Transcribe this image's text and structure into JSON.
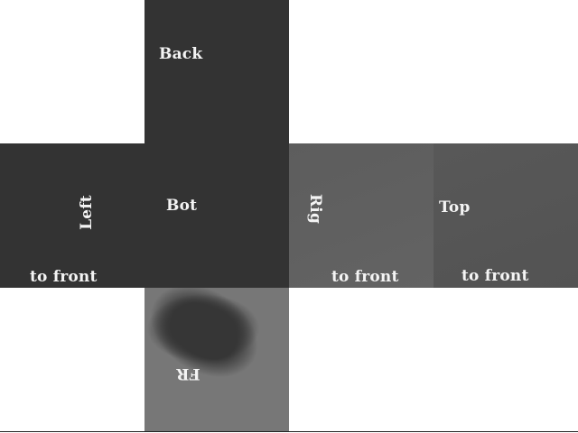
{
  "faces": {
    "back": {
      "label": "Back"
    },
    "left": {
      "label": "Left",
      "hint": "to front"
    },
    "bottom": {
      "label": "Bot"
    },
    "right": {
      "label": "Rig",
      "hint": "to front"
    },
    "top": {
      "label": "Top",
      "hint": "to front"
    },
    "front": {
      "label": "FR"
    }
  },
  "colors": {
    "background": "#ffffff",
    "dark_face": "#333333",
    "right_face": "#606060",
    "top_face": "#565656",
    "front_face": "#777777",
    "text": "#f4f4f4"
  }
}
